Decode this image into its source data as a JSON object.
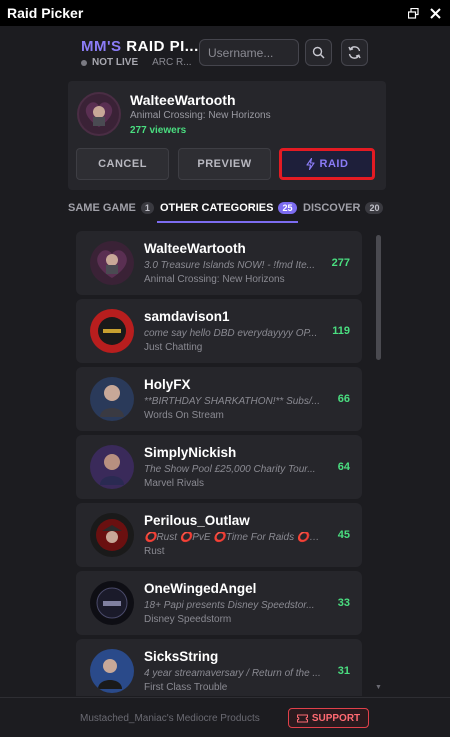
{
  "window": {
    "title": "Raid Picker"
  },
  "header": {
    "brand_prefix": "MM'S",
    "brand_suffix": "RAID PI...",
    "status": "NOT LIVE",
    "category": "ARC R...",
    "search_placeholder": "Username..."
  },
  "featured": {
    "name": "WalteeWartooth",
    "game": "Animal Crossing: New Horizons",
    "viewers": "277 viewers",
    "cancel_label": "CANCEL",
    "preview_label": "PREVIEW",
    "raid_label": "RAID"
  },
  "tabs": [
    {
      "label": "SAME GAME",
      "count": "1"
    },
    {
      "label": "OTHER CATEGORIES",
      "count": "25"
    },
    {
      "label": "DISCOVER",
      "count": "20"
    }
  ],
  "streams": [
    {
      "name": "WalteeWartooth",
      "title": "3.0 Treasure Islands NOW! - !fmd Ite...",
      "game": "Animal Crossing: New Horizons",
      "viewers": "277"
    },
    {
      "name": "samdavison1",
      "title": "come say hello DBD everydayyyy OP...",
      "game": "Just Chatting",
      "viewers": "119"
    },
    {
      "name": "HolyFX",
      "title": "**BIRTHDAY SHARKATHON!** Subs/...",
      "game": "Words On Stream",
      "viewers": "66"
    },
    {
      "name": "SimplyNickish",
      "title": "The Show Pool £25,000 Charity Tour...",
      "game": "Marvel Rivals",
      "viewers": "64"
    },
    {
      "name": "Perilous_Outlaw",
      "title": "⭕Rust ⭕PvE ⭕Time For Raids ⭕Ha...",
      "game": "Rust",
      "viewers": "45"
    },
    {
      "name": "OneWingedAngel",
      "title": "18+ Papi presents Disney Speedstor...",
      "game": "Disney Speedstorm",
      "viewers": "33"
    },
    {
      "name": "SicksString",
      "title": "4 year streamaversary / Return of the ...",
      "game": "First Class Trouble",
      "viewers": "31"
    }
  ],
  "footer": {
    "credit": "Mustached_Maniac's Mediocre Products",
    "support_label": "SUPPORT"
  },
  "colors": {
    "accent": "#7c6cf0",
    "viewers": "#4ade80",
    "highlight": "#e31b23"
  },
  "icons": [
    "restore-window-icon",
    "close-icon",
    "search-icon",
    "refresh-icon",
    "lightning-icon",
    "ticket-icon"
  ]
}
